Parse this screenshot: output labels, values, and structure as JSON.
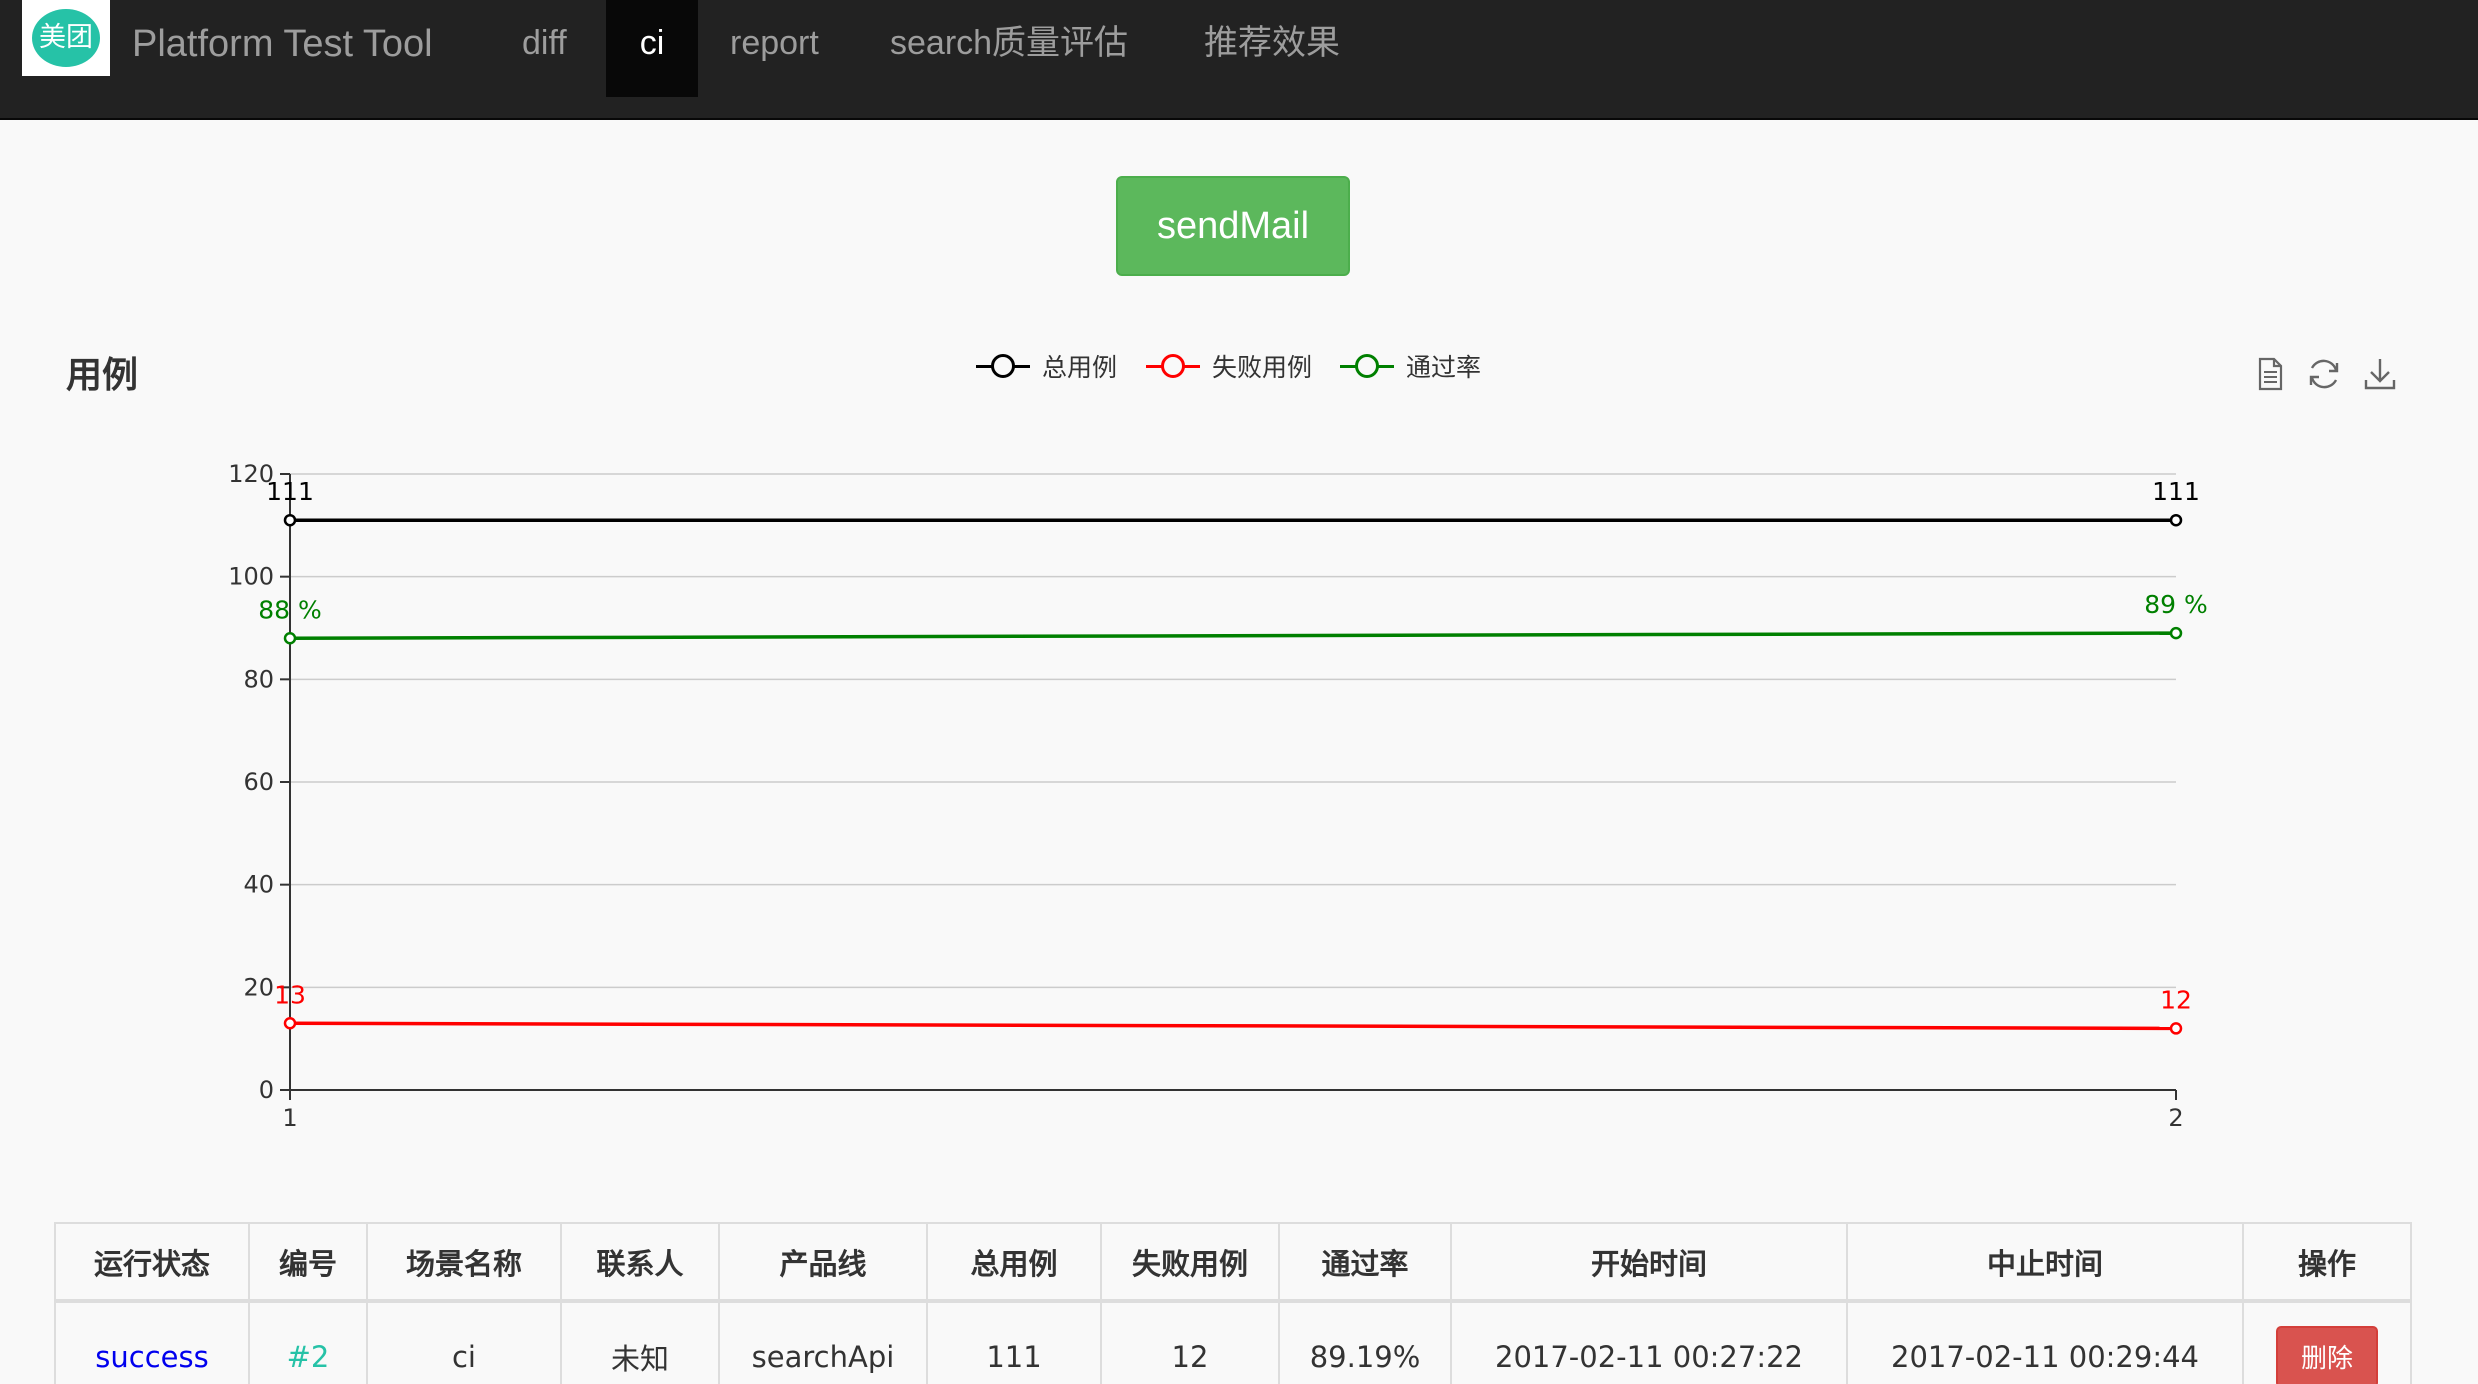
{
  "navbar": {
    "logo_text": "美团",
    "brand": "Platform Test Tool",
    "items": [
      {
        "label": "diff"
      },
      {
        "label": "ci"
      },
      {
        "label": "report"
      },
      {
        "label": "search质量评估"
      },
      {
        "label": "推荐效果"
      }
    ],
    "active_item": "ci"
  },
  "send_mail_label": "sendMail",
  "chart": {
    "title": "用例",
    "toolbox_icons": [
      "data-view-icon",
      "refresh-icon",
      "download-icon"
    ]
  },
  "chart_data": {
    "type": "line",
    "title": "用例",
    "categories": [
      "1",
      "2"
    ],
    "series": [
      {
        "name": "总用例",
        "values": [
          111,
          111
        ],
        "labels": [
          "111",
          "111"
        ],
        "color": "#000000"
      },
      {
        "name": "失败用例",
        "values": [
          13,
          12
        ],
        "labels": [
          "13",
          "12"
        ],
        "color": "#ff0000"
      },
      {
        "name": "通过率",
        "values": [
          88,
          89
        ],
        "labels": [
          "88 %",
          "89 %"
        ],
        "color": "#008000"
      }
    ],
    "ylim": [
      0,
      120
    ],
    "yticks": [
      "0",
      "20",
      "40",
      "60",
      "80",
      "100",
      "120"
    ],
    "grid": true,
    "legend_position": "top-center"
  },
  "table": {
    "headers": [
      "运行状态",
      "编号",
      "场景名称",
      "联系人",
      "产品线",
      "总用例",
      "失败用例",
      "通过率",
      "开始时间",
      "中止时间",
      "操作"
    ],
    "rows": [
      {
        "status": "success",
        "id": "#2",
        "scene": "ci",
        "contact": "未知",
        "product_line": "searchApi",
        "total": "111",
        "failed": "12",
        "pass_rate": "89.19%",
        "start_time": "2017-02-11 00:27:22",
        "end_time": "2017-02-11 00:29:44",
        "action": "删除"
      }
    ]
  },
  "colors": {
    "navbar_bg": "#222222",
    "nav_active_bg": "#080808",
    "send_button": "#5cb85c",
    "delete_button": "#d9534f",
    "status_link": "#0000ee",
    "id_link": "#26c2a7"
  }
}
